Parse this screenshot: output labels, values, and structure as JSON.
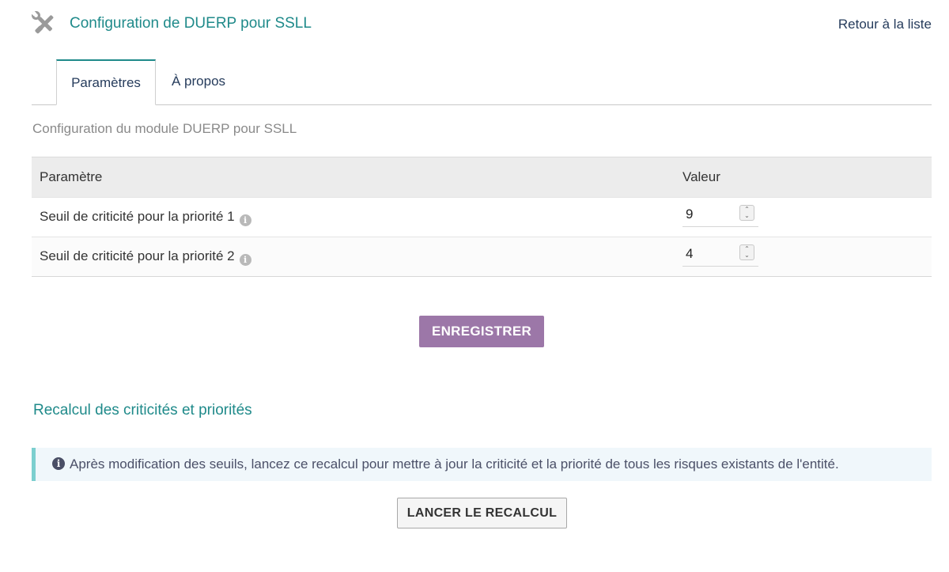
{
  "header": {
    "title": "Configuration de DUERP pour SSLL",
    "back_link": "Retour à la liste",
    "icon": "tools-icon"
  },
  "tabs": [
    {
      "label": "Paramètres",
      "active": true
    },
    {
      "label": "À propos",
      "active": false
    }
  ],
  "subtitle": "Configuration du module DUERP pour SSLL",
  "table": {
    "columns": [
      "Paramètre",
      "Valeur"
    ],
    "rows": [
      {
        "label": "Seuil de criticité pour la priorité 1",
        "value": "9"
      },
      {
        "label": "Seuil de criticité pour la priorité 2",
        "value": "4"
      }
    ]
  },
  "save_button": "ENREGISTRER",
  "recalc_section": {
    "title": "Recalcul des criticités et priorités",
    "info": "Après modification des seuils, lancez ce recalcul pour mettre à jour la criticité et la priorité de tous les risques existants de l'entité.",
    "button": "LANCER LE RECALCUL"
  },
  "colors": {
    "accent": "#1f8a8a",
    "save_button": "#9c77a8",
    "info_border": "#7ccfcf",
    "info_background": "#f0f7fb",
    "link": "#263c5c"
  }
}
